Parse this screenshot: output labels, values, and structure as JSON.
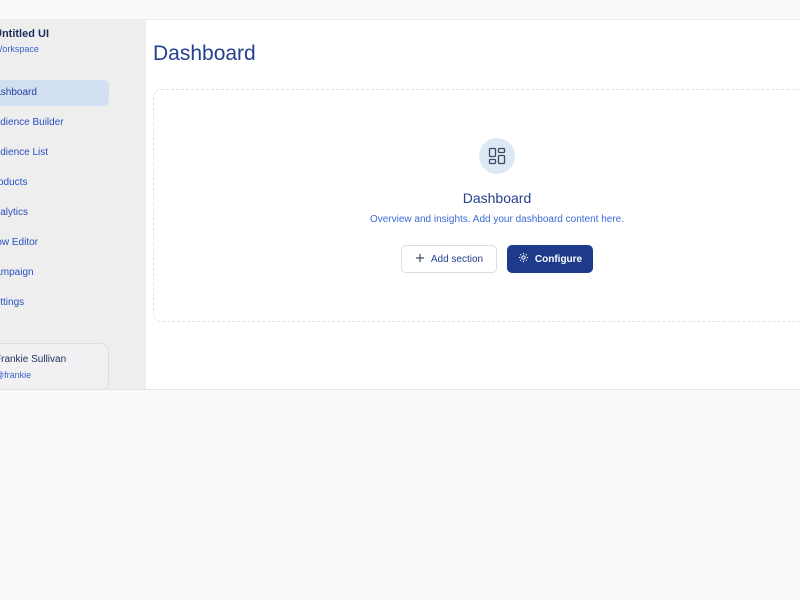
{
  "workspace": {
    "title": "Untitled UI",
    "subtitle": "Workspace"
  },
  "sidebar": {
    "items": [
      {
        "label": "Dashboard",
        "active": true
      },
      {
        "label": "Audience Builder",
        "active": false
      },
      {
        "label": "Audience List",
        "active": false
      },
      {
        "label": "Products",
        "active": false
      },
      {
        "label": "Analytics",
        "active": false
      },
      {
        "label": "Flow Editor",
        "active": false
      },
      {
        "label": "Campaign",
        "active": false
      },
      {
        "label": "Settings",
        "active": false
      }
    ],
    "user": {
      "name": "Frankie Sullivan",
      "handle": "@frankie"
    }
  },
  "main": {
    "title": "Dashboard",
    "empty_state": {
      "title": "Dashboard",
      "subtitle": "Overview and insights. Add your dashboard content here.",
      "add_label": "Add section",
      "configure_label": "Configure"
    }
  },
  "colors": {
    "accent": "#1e3a8a",
    "link": "#3a63c9",
    "active_bg": "#d2dff3"
  }
}
